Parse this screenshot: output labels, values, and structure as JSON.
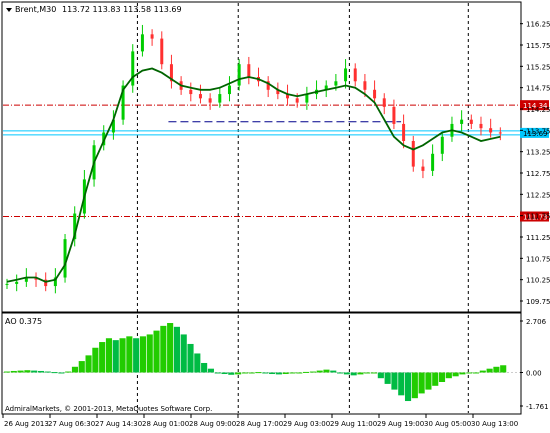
{
  "header": {
    "symbol_label": "Brent,M30",
    "ohlc": "113.72 113.83 113.58 113.69"
  },
  "indicator": {
    "label": "AO 0.375"
  },
  "footer": {
    "copyright": "AdmiralMarkets, © 2001-2013, MetaQuotes Software Corp."
  },
  "colors": {
    "bull": "#00cc00",
    "bear": "#ff3030",
    "ma": "#006400",
    "level": "#cc0000",
    "trend": "#00008b",
    "current": "#00c8ff",
    "ao_up": "#22cc00",
    "ao_down": "#00bb44"
  },
  "chart_data": [
    {
      "type": "candlestick",
      "title": "Brent,M30",
      "subtitle": "113.72 113.83 113.58 113.69",
      "ylim": [
        109.75,
        116.5
      ],
      "y_ticks": [
        "116.25",
        "115.75",
        "115.25",
        "114.75",
        "114.25",
        "113.75",
        "113.25",
        "112.75",
        "112.25",
        "111.75",
        "111.25",
        "110.75",
        "110.25",
        "109.75"
      ],
      "x_labels": [
        "26 Aug 2013",
        "27 Aug 06:30",
        "27 Aug 14:30",
        "28 Aug 01:00",
        "28 Aug 09:00",
        "28 Aug 17:00",
        "29 Aug 03:00",
        "29 Aug 11:00",
        "29 Aug 19:00",
        "30 Aug 05:00",
        "30 Aug 13:00"
      ],
      "horizontal_levels": [
        {
          "label": "114.34",
          "value": 114.34,
          "style": "red dash-dot"
        },
        {
          "label": "111.73",
          "value": 111.73,
          "style": "red dash-dot"
        }
      ],
      "current_price": {
        "label": "113.69",
        "value": 113.69
      },
      "trend_line": {
        "y": 113.95
      },
      "close": [
        110.15,
        110.2,
        110.3,
        110.25,
        110.1,
        110.3,
        111.2,
        111.8,
        112.6,
        113.4,
        113.7,
        114.0,
        114.8,
        115.6,
        116.0,
        115.9,
        115.3,
        114.9,
        114.7,
        114.6,
        114.5,
        114.4,
        114.6,
        114.8,
        115.3,
        115.0,
        114.9,
        114.7,
        114.6,
        114.5,
        114.4,
        114.6,
        114.7,
        114.8,
        114.9,
        115.2,
        114.9,
        114.7,
        114.5,
        114.3,
        113.9,
        113.5,
        112.9,
        112.8,
        113.2,
        113.6,
        113.9,
        114.0,
        113.9,
        113.8,
        113.7,
        113.69
      ],
      "ma_close": [
        110.2,
        110.25,
        110.3,
        110.3,
        110.2,
        110.25,
        110.6,
        111.3,
        112.2,
        113.0,
        113.5,
        114.0,
        114.7,
        115.0,
        115.15,
        115.2,
        115.1,
        114.95,
        114.8,
        114.75,
        114.7,
        114.7,
        114.75,
        114.85,
        114.95,
        115.0,
        114.95,
        114.85,
        114.7,
        114.6,
        114.55,
        114.6,
        114.65,
        114.7,
        114.75,
        114.8,
        114.75,
        114.6,
        114.4,
        114.0,
        113.6,
        113.4,
        113.3,
        113.4,
        113.55,
        113.7,
        113.75,
        113.7,
        113.6,
        113.5,
        113.55,
        113.6
      ]
    },
    {
      "type": "bar",
      "title": "AO 0.375",
      "ylim": [
        -1.761,
        2.706
      ],
      "y_ticks": [
        "2.706",
        "0.00",
        "-1.761"
      ],
      "values": [
        0.05,
        0.08,
        0.1,
        0.12,
        0.1,
        0.08,
        0.05,
        0.02,
        0.0,
        0.05,
        0.3,
        0.6,
        0.9,
        1.3,
        1.6,
        1.8,
        1.7,
        1.8,
        1.9,
        1.8,
        1.9,
        2.0,
        2.2,
        2.45,
        2.6,
        2.4,
        2.0,
        1.5,
        1.0,
        0.5,
        0.2,
        0.0,
        -0.08,
        -0.12,
        -0.1,
        -0.05,
        0.0,
        0.02,
        -0.05,
        -0.08,
        -0.1,
        -0.08,
        -0.04,
        0.0,
        0.03,
        0.05,
        0.1,
        0.15,
        0.1,
        -0.05,
        -0.1,
        -0.15,
        -0.1,
        -0.05,
        0.0,
        -0.3,
        -0.6,
        -0.9,
        -1.2,
        -1.5,
        -1.35,
        -1.1,
        -0.9,
        -0.7,
        -0.5,
        -0.3,
        -0.2,
        -0.1,
        -0.05,
        0.0,
        0.1,
        0.2,
        0.3,
        0.38
      ]
    }
  ]
}
